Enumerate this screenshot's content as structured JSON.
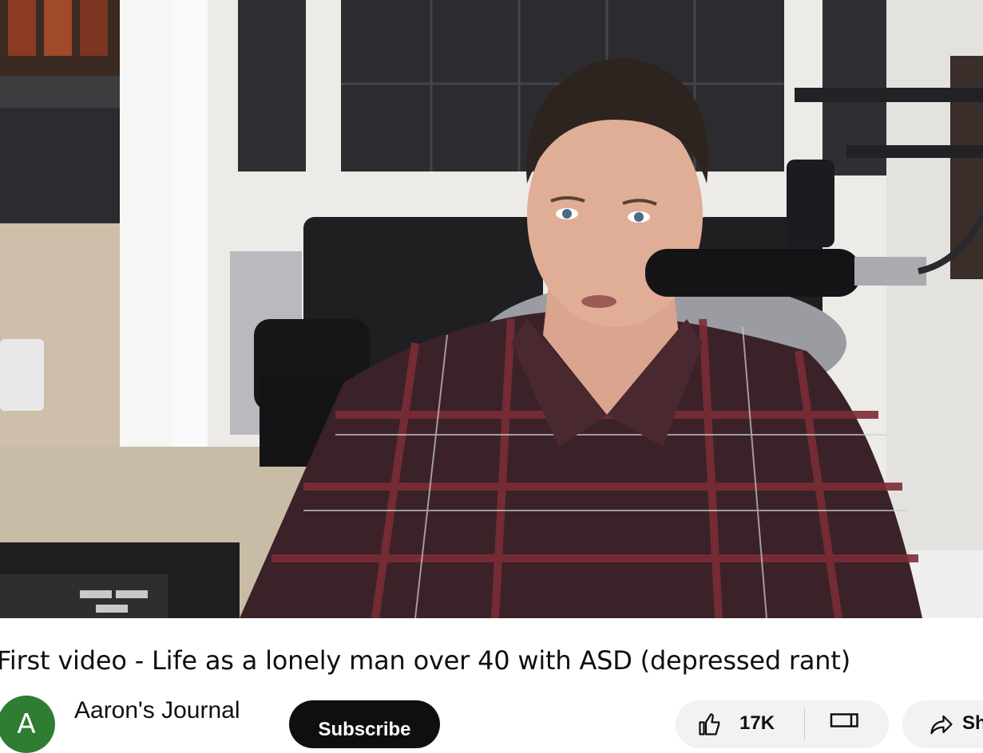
{
  "video": {
    "frame_description_icon": "video-frame"
  },
  "title": "First video - Life as a lonely man over 40 with ASD (depressed rant)",
  "channel": {
    "avatar_letter": "A",
    "name": "Aaron's Journal",
    "avatar_color": "#2e7d32"
  },
  "actions": {
    "subscribe_label": "Subscribe",
    "like_count": "17K",
    "share_label": "Share",
    "like_icon": "thumbs-up-icon",
    "dislike_icon": "thumbs-down-icon",
    "share_icon": "share-arrow-icon"
  },
  "colors": {
    "subscribe_bg": "#0f0f0f",
    "pill_bg": "#f2f2f2"
  }
}
